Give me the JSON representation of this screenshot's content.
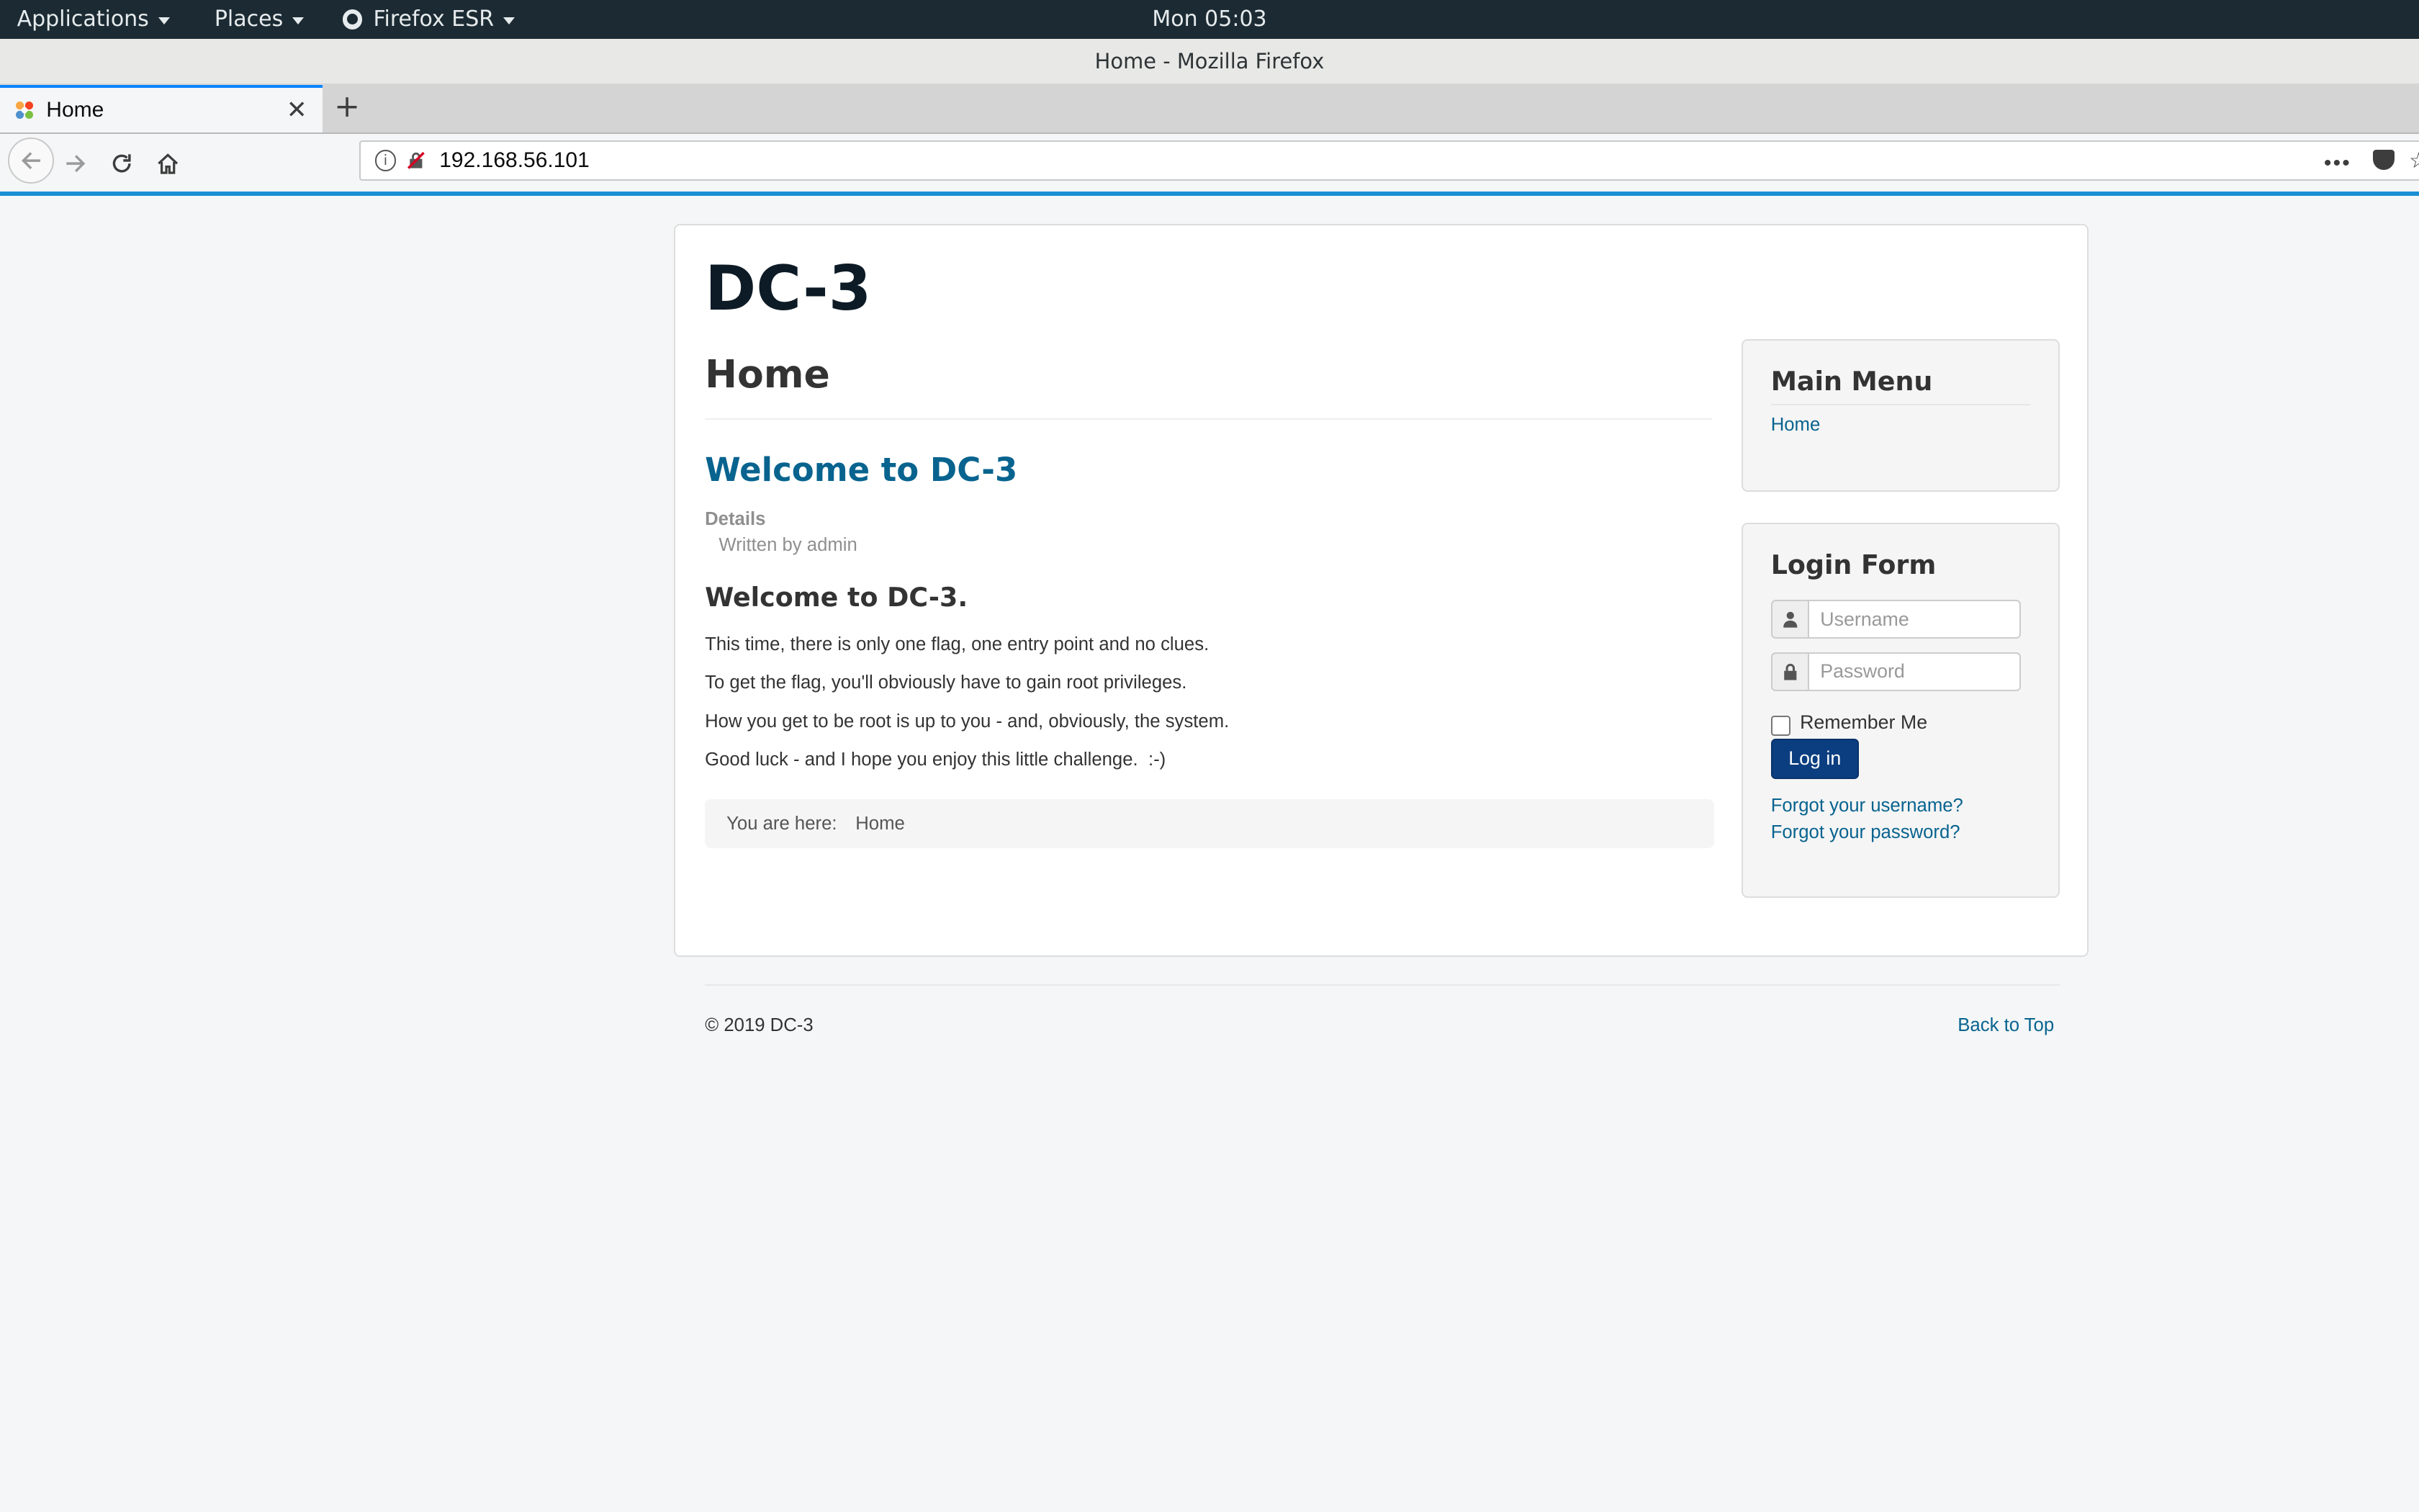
{
  "desktop": {
    "menus": [
      {
        "label": "Applications"
      },
      {
        "label": "Places"
      },
      {
        "label": "Firefox ESR"
      }
    ],
    "clock": "Mon 05:03"
  },
  "browser": {
    "window_title": "Home - Mozilla Firefox",
    "tabs": [
      {
        "label": "Home",
        "active": true,
        "favicon": "joomla-icon"
      }
    ],
    "url": "192.168.56.101",
    "accent_color": "#1a8fd6"
  },
  "site": {
    "brand": "DC-3",
    "page_title": "Home",
    "article": {
      "title": "Welcome to DC-3",
      "details_label": "Details",
      "written_by": "Written by admin",
      "heading": "Welcome to DC-3.",
      "paragraphs": [
        "This time, there is only one flag, one entry point and no clues.",
        "To get the flag, you'll obviously have to gain root privileges.",
        "How you get to be root is up to you - and, obviously, the system.",
        "Good luck - and I hope you enjoy this little challenge.  :-)"
      ]
    },
    "breadcrumb": {
      "label": "You are here:",
      "items": [
        "Home"
      ]
    },
    "main_menu": {
      "title": "Main Menu",
      "items": [
        "Home"
      ]
    },
    "login_form": {
      "title": "Login Form",
      "username_placeholder": "Username",
      "password_placeholder": "Password",
      "username_value": "",
      "password_value": "",
      "remember_label": "Remember Me",
      "remember_checked": false,
      "login_button": "Log in",
      "forgot_username": "Forgot your username?",
      "forgot_password": "Forgot your password?"
    },
    "footer": {
      "copyright": "© 2019 DC-3",
      "back_to_top": "Back to Top"
    },
    "link_color": "#08638f",
    "button_color": "#0b3e80"
  }
}
